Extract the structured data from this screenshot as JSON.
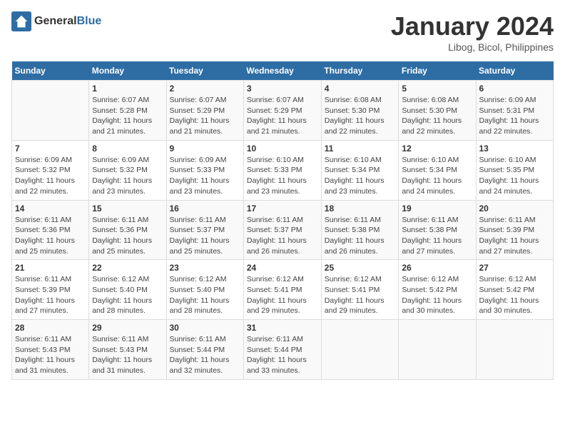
{
  "header": {
    "logo_general": "General",
    "logo_blue": "Blue",
    "title": "January 2024",
    "subtitle": "Libog, Bicol, Philippines"
  },
  "calendar": {
    "days_of_week": [
      "Sunday",
      "Monday",
      "Tuesday",
      "Wednesday",
      "Thursday",
      "Friday",
      "Saturday"
    ],
    "weeks": [
      [
        {
          "day": "",
          "info": ""
        },
        {
          "day": "1",
          "info": "Sunrise: 6:07 AM\nSunset: 5:28 PM\nDaylight: 11 hours and 21 minutes."
        },
        {
          "day": "2",
          "info": "Sunrise: 6:07 AM\nSunset: 5:29 PM\nDaylight: 11 hours and 21 minutes."
        },
        {
          "day": "3",
          "info": "Sunrise: 6:07 AM\nSunset: 5:29 PM\nDaylight: 11 hours and 21 minutes."
        },
        {
          "day": "4",
          "info": "Sunrise: 6:08 AM\nSunset: 5:30 PM\nDaylight: 11 hours and 22 minutes."
        },
        {
          "day": "5",
          "info": "Sunrise: 6:08 AM\nSunset: 5:30 PM\nDaylight: 11 hours and 22 minutes."
        },
        {
          "day": "6",
          "info": "Sunrise: 6:09 AM\nSunset: 5:31 PM\nDaylight: 11 hours and 22 minutes."
        }
      ],
      [
        {
          "day": "7",
          "info": "Sunrise: 6:09 AM\nSunset: 5:32 PM\nDaylight: 11 hours and 22 minutes."
        },
        {
          "day": "8",
          "info": "Sunrise: 6:09 AM\nSunset: 5:32 PM\nDaylight: 11 hours and 23 minutes."
        },
        {
          "day": "9",
          "info": "Sunrise: 6:09 AM\nSunset: 5:33 PM\nDaylight: 11 hours and 23 minutes."
        },
        {
          "day": "10",
          "info": "Sunrise: 6:10 AM\nSunset: 5:33 PM\nDaylight: 11 hours and 23 minutes."
        },
        {
          "day": "11",
          "info": "Sunrise: 6:10 AM\nSunset: 5:34 PM\nDaylight: 11 hours and 23 minutes."
        },
        {
          "day": "12",
          "info": "Sunrise: 6:10 AM\nSunset: 5:34 PM\nDaylight: 11 hours and 24 minutes."
        },
        {
          "day": "13",
          "info": "Sunrise: 6:10 AM\nSunset: 5:35 PM\nDaylight: 11 hours and 24 minutes."
        }
      ],
      [
        {
          "day": "14",
          "info": "Sunrise: 6:11 AM\nSunset: 5:36 PM\nDaylight: 11 hours and 25 minutes."
        },
        {
          "day": "15",
          "info": "Sunrise: 6:11 AM\nSunset: 5:36 PM\nDaylight: 11 hours and 25 minutes."
        },
        {
          "day": "16",
          "info": "Sunrise: 6:11 AM\nSunset: 5:37 PM\nDaylight: 11 hours and 25 minutes."
        },
        {
          "day": "17",
          "info": "Sunrise: 6:11 AM\nSunset: 5:37 PM\nDaylight: 11 hours and 26 minutes."
        },
        {
          "day": "18",
          "info": "Sunrise: 6:11 AM\nSunset: 5:38 PM\nDaylight: 11 hours and 26 minutes."
        },
        {
          "day": "19",
          "info": "Sunrise: 6:11 AM\nSunset: 5:38 PM\nDaylight: 11 hours and 27 minutes."
        },
        {
          "day": "20",
          "info": "Sunrise: 6:11 AM\nSunset: 5:39 PM\nDaylight: 11 hours and 27 minutes."
        }
      ],
      [
        {
          "day": "21",
          "info": "Sunrise: 6:11 AM\nSunset: 5:39 PM\nDaylight: 11 hours and 27 minutes."
        },
        {
          "day": "22",
          "info": "Sunrise: 6:12 AM\nSunset: 5:40 PM\nDaylight: 11 hours and 28 minutes."
        },
        {
          "day": "23",
          "info": "Sunrise: 6:12 AM\nSunset: 5:40 PM\nDaylight: 11 hours and 28 minutes."
        },
        {
          "day": "24",
          "info": "Sunrise: 6:12 AM\nSunset: 5:41 PM\nDaylight: 11 hours and 29 minutes."
        },
        {
          "day": "25",
          "info": "Sunrise: 6:12 AM\nSunset: 5:41 PM\nDaylight: 11 hours and 29 minutes."
        },
        {
          "day": "26",
          "info": "Sunrise: 6:12 AM\nSunset: 5:42 PM\nDaylight: 11 hours and 30 minutes."
        },
        {
          "day": "27",
          "info": "Sunrise: 6:12 AM\nSunset: 5:42 PM\nDaylight: 11 hours and 30 minutes."
        }
      ],
      [
        {
          "day": "28",
          "info": "Sunrise: 6:11 AM\nSunset: 5:43 PM\nDaylight: 11 hours and 31 minutes."
        },
        {
          "day": "29",
          "info": "Sunrise: 6:11 AM\nSunset: 5:43 PM\nDaylight: 11 hours and 31 minutes."
        },
        {
          "day": "30",
          "info": "Sunrise: 6:11 AM\nSunset: 5:44 PM\nDaylight: 11 hours and 32 minutes."
        },
        {
          "day": "31",
          "info": "Sunrise: 6:11 AM\nSunset: 5:44 PM\nDaylight: 11 hours and 33 minutes."
        },
        {
          "day": "",
          "info": ""
        },
        {
          "day": "",
          "info": ""
        },
        {
          "day": "",
          "info": ""
        }
      ]
    ]
  }
}
